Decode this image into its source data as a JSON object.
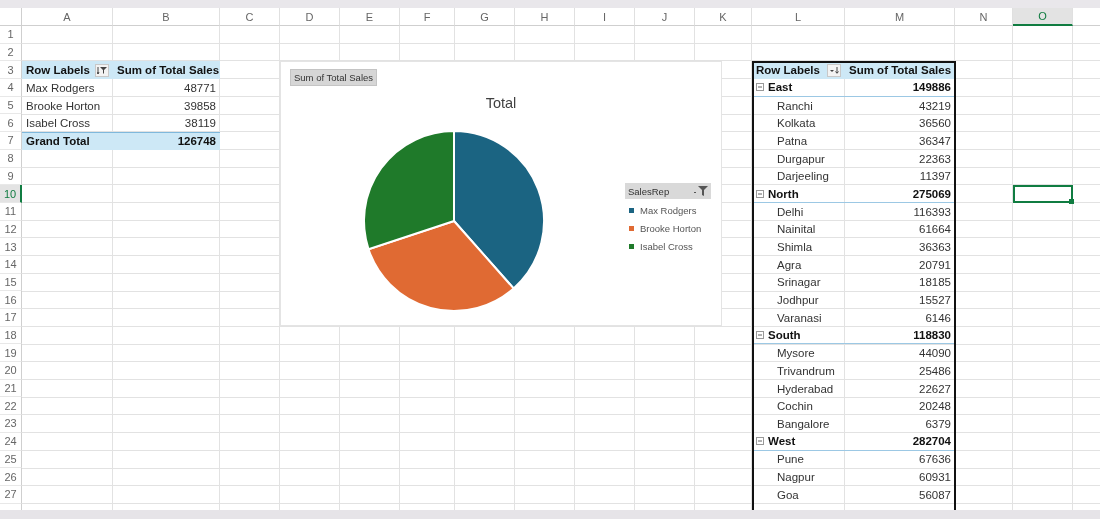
{
  "columns": [
    {
      "label": "A",
      "selected": false
    },
    {
      "label": "B",
      "selected": false
    },
    {
      "label": "C",
      "selected": false
    },
    {
      "label": "D",
      "selected": false
    },
    {
      "label": "E",
      "selected": false
    },
    {
      "label": "F",
      "selected": false
    },
    {
      "label": "G",
      "selected": false
    },
    {
      "label": "H",
      "selected": false
    },
    {
      "label": "I",
      "selected": false
    },
    {
      "label": "J",
      "selected": false
    },
    {
      "label": "K",
      "selected": false
    },
    {
      "label": "L",
      "selected": false
    },
    {
      "label": "M",
      "selected": false
    },
    {
      "label": "N",
      "selected": false
    },
    {
      "label": "O",
      "selected": true
    }
  ],
  "rows": [
    {
      "label": "1",
      "selected": false
    },
    {
      "label": "2",
      "selected": false
    },
    {
      "label": "3",
      "selected": false
    },
    {
      "label": "4",
      "selected": false
    },
    {
      "label": "5",
      "selected": false
    },
    {
      "label": "6",
      "selected": false
    },
    {
      "label": "7",
      "selected": false
    },
    {
      "label": "8",
      "selected": false
    },
    {
      "label": "9",
      "selected": false
    },
    {
      "label": "10",
      "selected": true
    },
    {
      "label": "11",
      "selected": false
    },
    {
      "label": "12",
      "selected": false
    },
    {
      "label": "13",
      "selected": false
    },
    {
      "label": "14",
      "selected": false
    },
    {
      "label": "15",
      "selected": false
    },
    {
      "label": "16",
      "selected": false
    },
    {
      "label": "17",
      "selected": false
    },
    {
      "label": "18",
      "selected": false
    },
    {
      "label": "19",
      "selected": false
    },
    {
      "label": "20",
      "selected": false
    },
    {
      "label": "21",
      "selected": false
    },
    {
      "label": "22",
      "selected": false
    },
    {
      "label": "23",
      "selected": false
    },
    {
      "label": "24",
      "selected": false
    },
    {
      "label": "25",
      "selected": false
    },
    {
      "label": "26",
      "selected": false
    },
    {
      "label": "27",
      "selected": false
    }
  ],
  "pivot_tables": [
    {
      "header": {
        "row_labels": "Row Labels",
        "values": "Sum of Total Sales",
        "button": {
          "kind": "filter"
        }
      },
      "rows": [
        {
          "label": "Max Rodgers",
          "value": "48771"
        },
        {
          "label": "Brooke Horton",
          "value": "39858"
        },
        {
          "label": "Isabel Cross",
          "value": "38119"
        }
      ],
      "grand_total": {
        "label": "Grand Total",
        "value": "126748"
      }
    },
    {
      "header": {
        "row_labels": "Row Labels",
        "values": "Sum of Total Sales",
        "button": {
          "kind": "sort"
        }
      },
      "rows": [
        {
          "label": "East",
          "value": "149886",
          "expanded": true,
          "children": [
            {
              "label": "Ranchi",
              "value": "43219"
            },
            {
              "label": "Kolkata",
              "value": "36560"
            },
            {
              "label": "Patna",
              "value": "36347"
            },
            {
              "label": "Durgapur",
              "value": "22363"
            },
            {
              "label": "Darjeeling",
              "value": "11397"
            }
          ]
        },
        {
          "label": "North",
          "value": "275069",
          "expanded": true,
          "children": [
            {
              "label": "Delhi",
              "value": "116393"
            },
            {
              "label": "Nainital",
              "value": "61664"
            },
            {
              "label": "Shimla",
              "value": "36363"
            },
            {
              "label": "Agra",
              "value": "20791"
            },
            {
              "label": "Srinagar",
              "value": "18185"
            },
            {
              "label": "Jodhpur",
              "value": "15527"
            },
            {
              "label": "Varanasi",
              "value": "6146"
            }
          ]
        },
        {
          "label": "South",
          "value": "118830",
          "expanded": true,
          "children": [
            {
              "label": "Mysore",
              "value": "44090"
            },
            {
              "label": "Trivandrum",
              "value": "25486"
            },
            {
              "label": "Hyderabad",
              "value": "22627"
            },
            {
              "label": "Cochin",
              "value": "20248"
            },
            {
              "label": "Bangalore",
              "value": "6379"
            }
          ]
        },
        {
          "label": "West",
          "value": "282704",
          "expanded": true,
          "children": [
            {
              "label": "Pune",
              "value": "67636"
            },
            {
              "label": "Nagpur",
              "value": "60931"
            },
            {
              "label": "Goa",
              "value": "56087"
            }
          ]
        }
      ]
    }
  ],
  "chart": {
    "chart_data": {
      "type": "pie",
      "title": "Total",
      "categories": [
        "Max Rodgers",
        "Brooke Horton",
        "Isabel Cross"
      ],
      "series": [
        {
          "name": "Sum of Total Sales",
          "values": [
            38.48,
            31.45,
            30.07
          ]
        }
      ],
      "colors": [
        "#1b6482",
        "#e06a33",
        "#1f7a2a"
      ],
      "legend": true
    },
    "legend_title": "SalesRep"
  }
}
